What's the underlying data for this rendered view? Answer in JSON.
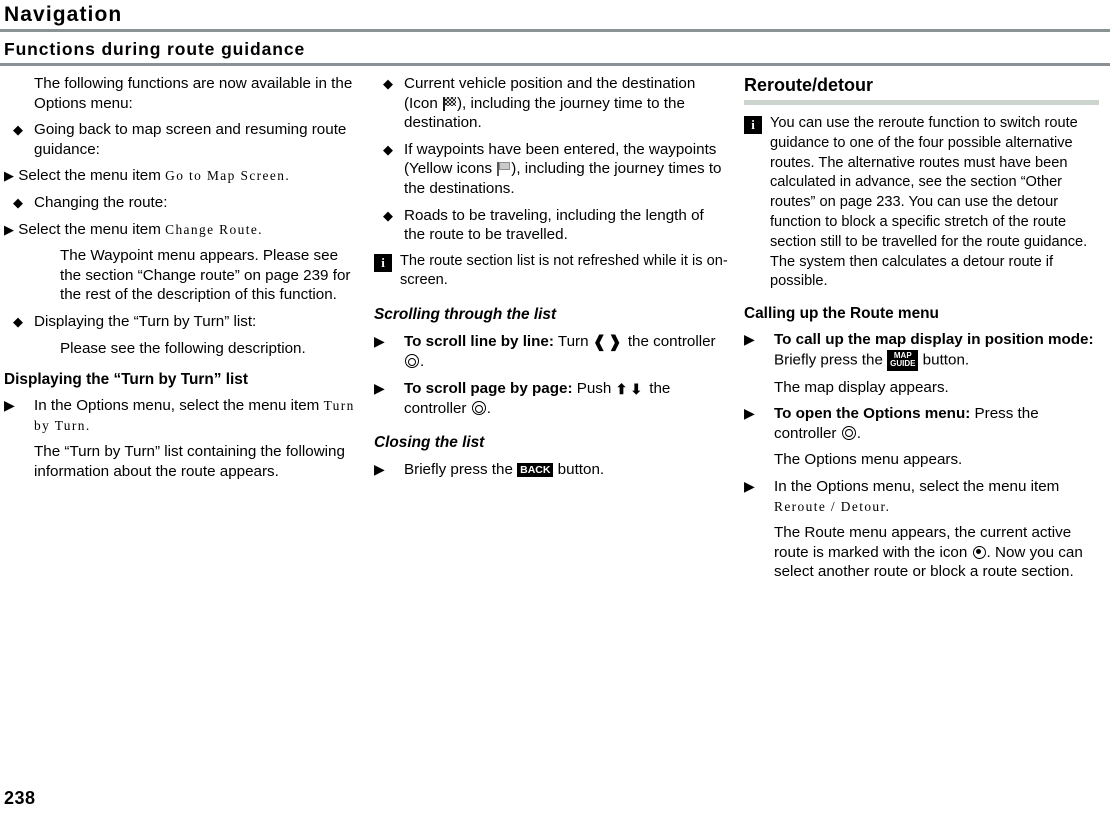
{
  "header": {
    "title": "Navigation",
    "section_title": "Functions during route guidance",
    "rule_color": "#8a9296"
  },
  "footer": {
    "page_number": "238"
  },
  "col1": {
    "intro": "The following functions are now available in the Options menu:",
    "bullet1_text": "Going back to map screen and resuming route guidance:",
    "bullet1_step_prefix": "Select the menu item ",
    "bullet1_menu_item": "Go to Map Screen.",
    "bullet2_text": "Changing the route:",
    "bullet2_step_prefix": "Select the menu item ",
    "bullet2_menu_item": "Change Route.",
    "bullet2_result": "The Waypoint menu appears. Please see the section “Change route” on page 239 for the rest of the description of this function.",
    "bullet3_text": "Displaying the “Turn by Turn” list:",
    "bullet3_result": "Please see the following description.",
    "subhead": "Displaying the “Turn by Turn” list",
    "step1_prefix": "In the Options menu, select the menu item ",
    "step1_menu_item": "Turn by Turn.",
    "step1_result": "The “Turn by Turn” list containing the following information about the route appears."
  },
  "col2": {
    "bullet1_a": "Current vehicle position and the destination (Icon ",
    "bullet1_b": "), including the journey time to the destination.",
    "bullet2_a": "If waypoints have been entered, the waypoints (Yellow icons ",
    "bullet2_b": "), including the journey times to the destinations.",
    "bullet3": "Roads to be traveling, including the length of the route to be travelled.",
    "note": "The route section list is not refreshed while it is on-screen.",
    "subhead_scrolling": "Scrolling through the list",
    "scroll_line_label": "To scroll line by line:",
    "scroll_line_mid": " Turn ",
    "scroll_line_end": " the controller ",
    "scroll_line_period": ".",
    "scroll_page_label": "To scroll page by page:",
    "scroll_page_mid": " Push ",
    "scroll_page_end": " the controller ",
    "scroll_page_period": ".",
    "subhead_closing": "Closing the list",
    "close_prefix": "Briefly press the ",
    "close_button": "BACK",
    "close_suffix": " button."
  },
  "col3": {
    "head": "Reroute/detour",
    "rule_color": "#ccd4ce",
    "note": "You can use the reroute function to switch route guidance to one of the four possible alternative routes. The alternative routes must have been calculated in advance, see the section “Other routes” on page 233. You can use the detour function to block a specific stretch of the route section still to be travelled for the route guidance. The system then calculates a detour route if possible.",
    "subhead": "Calling up the Route menu",
    "step1_label": "To call up the map display in position mode:",
    "step1_mid": " Briefly press the ",
    "step1_btn_line1": "MAP",
    "step1_btn_line2": "GUIDE",
    "step1_end": " button.",
    "step1_result": "The map display appears.",
    "step2_label": "To open the Options menu:",
    "step2_mid": " Press the controller ",
    "step2_period": ".",
    "step2_result": "The Options menu appears.",
    "step3_prefix": "In the Options menu, select the menu item ",
    "step3_menu_item": "Reroute / Detour.",
    "step3_result_a": "The Route menu appears, the current active route is marked with the icon ",
    "step3_result_b": ". Now you can select another route or block a route section."
  },
  "glyphs": {
    "bullet": "◆",
    "arrow": "▶",
    "turn_left": "❰",
    "turn_right": "❱",
    "push_up": "⬆",
    "push_down": "⬇",
    "info": "i"
  }
}
